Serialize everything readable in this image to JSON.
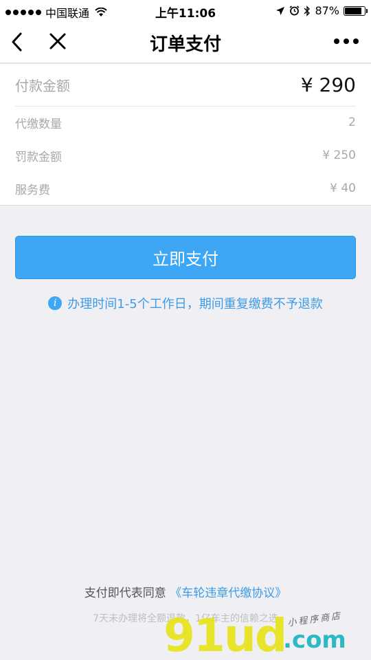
{
  "status_bar": {
    "carrier": "中国联通",
    "time": "上午11:06",
    "battery": "87%",
    "battery_level": 0.87
  },
  "nav": {
    "title": "订单支付"
  },
  "order": {
    "amount_label": "付款金额",
    "amount_value": "¥ 290",
    "rows": [
      {
        "label": "代缴数量",
        "value": "2"
      },
      {
        "label": "罚款金额",
        "value": "¥ 250"
      },
      {
        "label": "服务费",
        "value": "¥ 40"
      }
    ]
  },
  "pay_button": "立即支付",
  "notice": {
    "icon_text": "i",
    "text": "办理时间1-5个工作日，期间重复缴费不予退款"
  },
  "footer": {
    "agreement_prefix": "支付即代表同意",
    "agreement_link": "《车轮违章代缴协议》",
    "slogan": "7天未办理将全额退款，1亿车主的信赖之选"
  },
  "watermark": {
    "brand": "91ud",
    "domain": ".com",
    "tag": "小程序商店"
  },
  "colors": {
    "accent": "#3ea7f5",
    "link": "#3e9be6",
    "background": "#efeff4"
  }
}
